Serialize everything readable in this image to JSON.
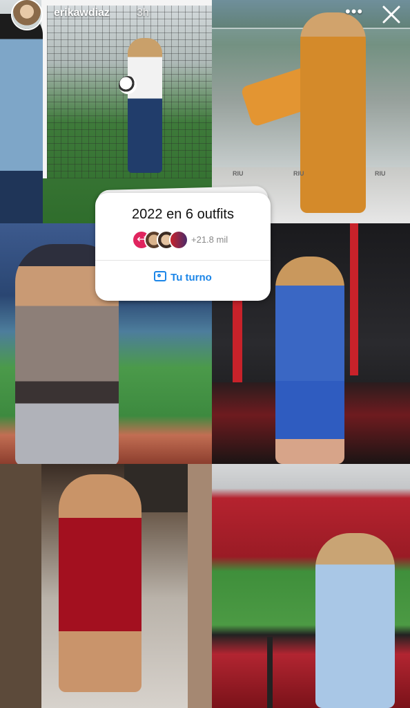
{
  "header": {
    "username": "erikawdiaz",
    "time_ago": "3h",
    "more_icon": "more-dots-icon",
    "close_icon": "close-icon"
  },
  "sticker": {
    "title": "2022 en 6 outfits",
    "participants_count": "+21.8 mil",
    "cta_label": "Tu turno",
    "cta_icon": "camera-icon",
    "cta_color": "#1c86e8",
    "arrow_color": "#e0245e"
  },
  "photos": {
    "p2_sign_1": "RIU",
    "p2_sign_2": "RIU",
    "p2_sign_3": "RIU"
  }
}
